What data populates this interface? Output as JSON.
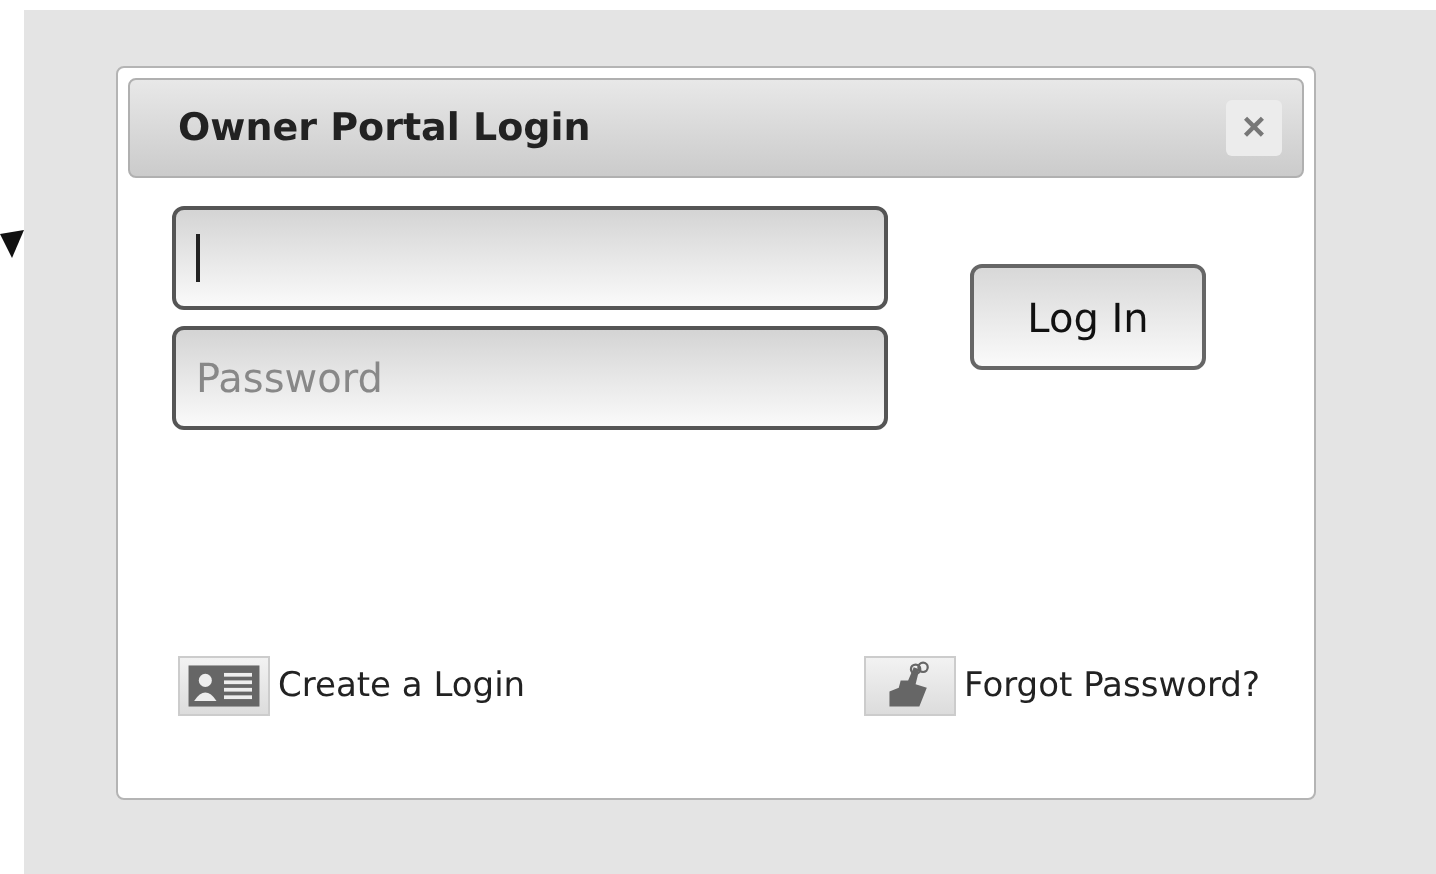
{
  "dialog": {
    "title": "Owner Portal Login",
    "close_label": "×"
  },
  "fields": [
    {
      "focused": true
    },
    {
      "placeholder": "Password",
      "focused": false
    }
  ],
  "login_button": "Log In",
  "links": [
    {
      "kind": "create",
      "label": "Create a Login"
    },
    {
      "kind": "forgot",
      "label": "Forgot Password?"
    }
  ]
}
